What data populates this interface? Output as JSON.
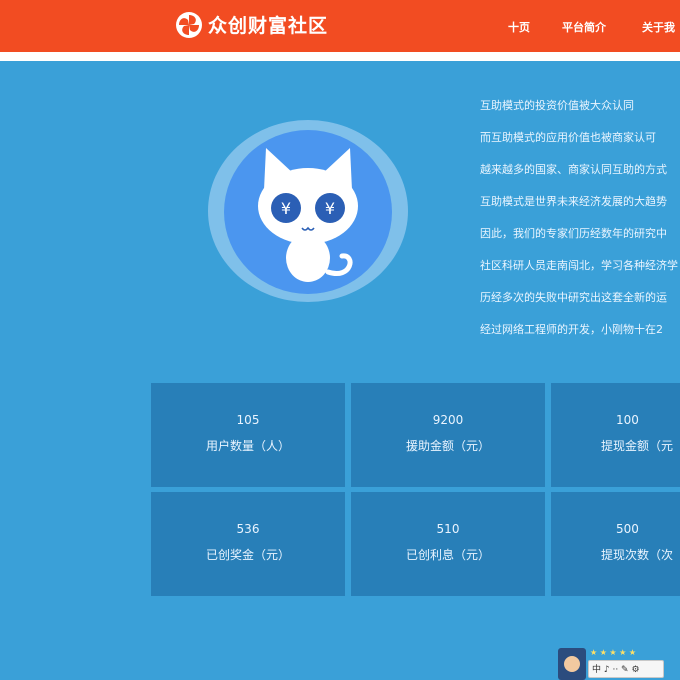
{
  "header": {
    "brand": "众创财富社区",
    "nav": [
      "十页",
      "平台简介",
      "关于我"
    ]
  },
  "colors": {
    "header_bg": "#f24c22",
    "page_bg": "#3aa0d8",
    "card_bg": "#287fb8",
    "mascot_bg": "#4b96ef"
  },
  "hero": {
    "mascot_icon": "cat-yen-eyes-icon",
    "eye_glyph": "¥",
    "description": [
      "互助模式的投资价值被大众认同",
      "而互助模式的应用价值也被商家认可",
      "越来越多的国家、商家认同互助的方式",
      "互助模式是世界未来经济发展的大趋势",
      "因此，我们的专家们历经数年的研究中",
      "社区科研人员走南闯北，学习各种经济学",
      "历经多次的失败中研究出这套全新的运",
      "经过网络工程师的开发，小刚物十在2"
    ]
  },
  "stats": [
    {
      "value": "105",
      "label": "用户数量（人）"
    },
    {
      "value": "9200",
      "label": "援助金额（元）"
    },
    {
      "value": "100",
      "label": "提现金额（元"
    },
    {
      "value": "536",
      "label": "已创奖金（元）"
    },
    {
      "value": "510",
      "label": "已创利息（元）"
    },
    {
      "value": "500",
      "label": "提现次数（次"
    }
  ],
  "widget": {
    "stars": "★ ★ ★ ★ ★",
    "text": "中 ♪ ·· ✎ ⚙"
  }
}
